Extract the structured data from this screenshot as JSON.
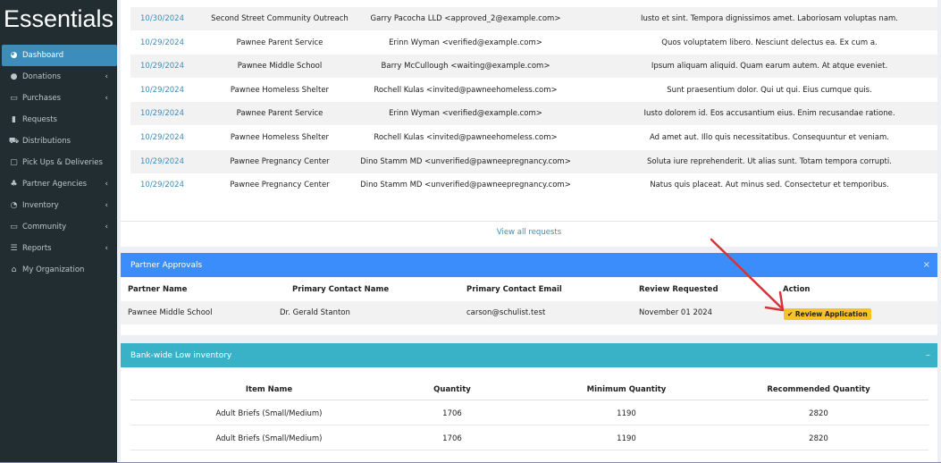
{
  "sidebar": {
    "logo": "Essentials",
    "items": [
      {
        "label": "Dashboard",
        "icon": "dashboard-icon",
        "glyph": "◕",
        "caret": ""
      },
      {
        "label": "Donations",
        "icon": "donations-icon",
        "glyph": "●",
        "caret": "‹"
      },
      {
        "label": "Purchases",
        "icon": "purchases-icon",
        "glyph": "▭",
        "caret": "‹"
      },
      {
        "label": "Requests",
        "icon": "requests-icon",
        "glyph": "▮",
        "caret": ""
      },
      {
        "label": "Distributions",
        "icon": "cart-icon",
        "glyph": "⛟",
        "caret": ""
      },
      {
        "label": "Pick Ups & Deliveries",
        "icon": "calendar-icon",
        "glyph": "▢",
        "caret": ""
      },
      {
        "label": "Partner Agencies",
        "icon": "users-icon",
        "glyph": "♣",
        "caret": "‹"
      },
      {
        "label": "Inventory",
        "icon": "pie-chart-icon",
        "glyph": "◔",
        "caret": "‹"
      },
      {
        "label": "Community",
        "icon": "laptop-icon",
        "glyph": "▭",
        "caret": "‹"
      },
      {
        "label": "Reports",
        "icon": "list-icon",
        "glyph": "☰",
        "caret": "‹"
      },
      {
        "label": "My Organization",
        "icon": "home-icon",
        "glyph": "⌂",
        "caret": ""
      }
    ]
  },
  "requests": {
    "rows": [
      {
        "date": "10/30/2024",
        "partner": "Second Street Community Outreach",
        "contact": "Garry Pacocha LLD <approved_2@example.com>",
        "comment": "Iusto et sint. Tempora dignissimos amet. Laboriosam voluptas nam."
      },
      {
        "date": "10/29/2024",
        "partner": "Pawnee Parent Service",
        "contact": "Erinn Wyman <verified@example.com>",
        "comment": "Quos voluptatem libero. Nesciunt delectus ea. Ex cum a."
      },
      {
        "date": "10/29/2024",
        "partner": "Pawnee Middle School",
        "contact": "Barry McCullough <waiting@example.com>",
        "comment": "Ipsum aliquam aliquid. Quam earum autem. At atque eveniet."
      },
      {
        "date": "10/29/2024",
        "partner": "Pawnee Homeless Shelter",
        "contact": "Rochell Kulas <invited@pawneehomeless.com>",
        "comment": "Sunt praesentium dolor. Qui ut qui. Eius cumque quis."
      },
      {
        "date": "10/29/2024",
        "partner": "Pawnee Parent Service",
        "contact": "Erinn Wyman <verified@example.com>",
        "comment": "Iusto dolorem id. Eos accusantium eius. Enim recusandae ratione."
      },
      {
        "date": "10/29/2024",
        "partner": "Pawnee Homeless Shelter",
        "contact": "Rochell Kulas <invited@pawneehomeless.com>",
        "comment": "Ad amet aut. Illo quis necessitatibus. Consequuntur et veniam."
      },
      {
        "date": "10/29/2024",
        "partner": "Pawnee Pregnancy Center",
        "contact": "Dino Stamm MD <unverified@pawneepregnancy.com>",
        "comment": "Soluta iure reprehenderit. Ut alias sunt. Totam tempora corrupti."
      },
      {
        "date": "10/29/2024",
        "partner": "Pawnee Pregnancy Center",
        "contact": "Dino Stamm MD <unverified@pawneepregnancy.com>",
        "comment": "Natus quis placeat. Aut minus sed. Consectetur et temporibus."
      }
    ],
    "view_all": "View all requests"
  },
  "approvals": {
    "title": "Partner Approvals",
    "close": "×",
    "columns": [
      "Partner Name",
      "Primary Contact Name",
      "Primary Contact Email",
      "Review Requested",
      "Action"
    ],
    "row": {
      "partner": "Pawnee Middle School",
      "contact": "Dr. Gerald Stanton",
      "email": "carson@schulist.test",
      "requested": "November 01 2024",
      "action": "✔ Review Application"
    }
  },
  "inventory": {
    "title": "Bank-wide Low inventory",
    "minimize": "–",
    "columns": [
      "Item Name",
      "Quantity",
      "Minimum Quantity",
      "Recommended Quantity"
    ],
    "rows": [
      {
        "name": "Adult Briefs (Small/Medium)",
        "quantity": "1706",
        "minimum": "1190",
        "recommended": "2820"
      },
      {
        "name": "Adult Briefs (Small/Medium)",
        "quantity": "1706",
        "minimum": "1190",
        "recommended": "2820"
      }
    ]
  },
  "colors": {
    "accent": "#3c8dbc",
    "sidebar": "#222d32",
    "approvals_header": "#3c8dfc",
    "inventory_header": "#39b2c7",
    "action_button": "#f7c227",
    "annotation_arrow": "#d6323a"
  }
}
